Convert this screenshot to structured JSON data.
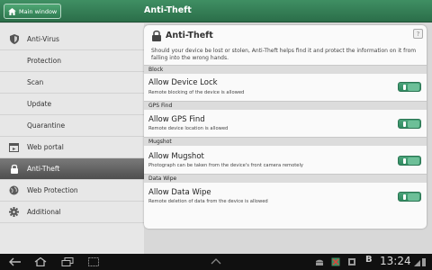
{
  "topbar": {
    "main_window_label": "Main window",
    "title": "Anti-Theft"
  },
  "sidebar": {
    "items": [
      {
        "label": "Anti-Virus",
        "icon": "shield-icon"
      },
      {
        "label": "Protection",
        "icon": ""
      },
      {
        "label": "Scan",
        "icon": ""
      },
      {
        "label": "Update",
        "icon": ""
      },
      {
        "label": "Quarantine",
        "icon": ""
      },
      {
        "label": "Web portal",
        "icon": "web-portal-icon"
      },
      {
        "label": "Anti-Theft",
        "icon": "lock-icon",
        "active": true
      },
      {
        "label": "Web Protection",
        "icon": "globe-icon"
      },
      {
        "label": "Additional",
        "icon": "gear-icon"
      }
    ]
  },
  "panel": {
    "title": "Anti-Theft",
    "help": "?",
    "description": "Should your device be lost or stolen, Anti-Theft helps find it and protect the information on it from falling into the wrong hands.",
    "sections": [
      {
        "header": "Block",
        "title": "Allow Device Lock",
        "sub": "Remote blocking of the device is allowed",
        "enabled": true
      },
      {
        "header": "GPS Find",
        "title": "Allow GPS Find",
        "sub": "Remote device location is allowed",
        "enabled": true
      },
      {
        "header": "Mugshot",
        "title": "Allow Mugshot",
        "sub": "Photograph can be taken from the device's front camera remotely",
        "enabled": true
      },
      {
        "header": "Data Wipe",
        "title": "Allow Data Wipe",
        "sub": "Remote deletion of data from the device is allowed",
        "enabled": true
      }
    ]
  },
  "statusbar": {
    "time": "13:24",
    "accent": "#3f8f63"
  }
}
